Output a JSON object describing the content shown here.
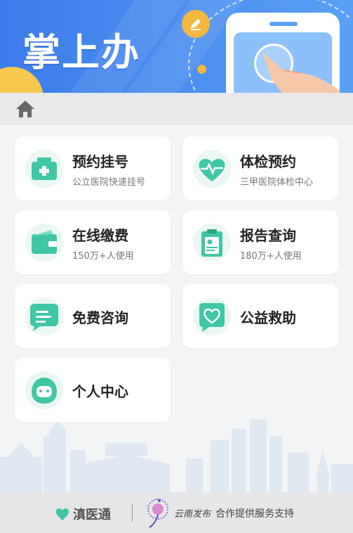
{
  "banner": {
    "title": "掌上办"
  },
  "services": [
    {
      "label": "预约挂号",
      "sub": "公立医院快速挂号",
      "icon": "hospital-cross-icon"
    },
    {
      "label": "体检预约",
      "sub": "三甲医院体检中心",
      "icon": "heart-pulse-icon"
    },
    {
      "label": "在线缴费",
      "sub": "150万+人使用",
      "icon": "wallet-icon"
    },
    {
      "label": "报告查询",
      "sub": "180万+人使用",
      "icon": "clipboard-report-icon"
    },
    {
      "label": "免费咨询",
      "icon": "chat-bubble-icon"
    },
    {
      "label": "公益救助",
      "icon": "heart-bubble-icon"
    },
    {
      "label": "个人中心",
      "icon": "user-face-icon"
    }
  ],
  "footer": {
    "brand": "滇医通",
    "partner": "云南发布",
    "support": "合作提供服务支持"
  },
  "colors": {
    "accent": "#3fc7a5",
    "banner": "#4a8cf0",
    "sun": "#f6c84f"
  }
}
